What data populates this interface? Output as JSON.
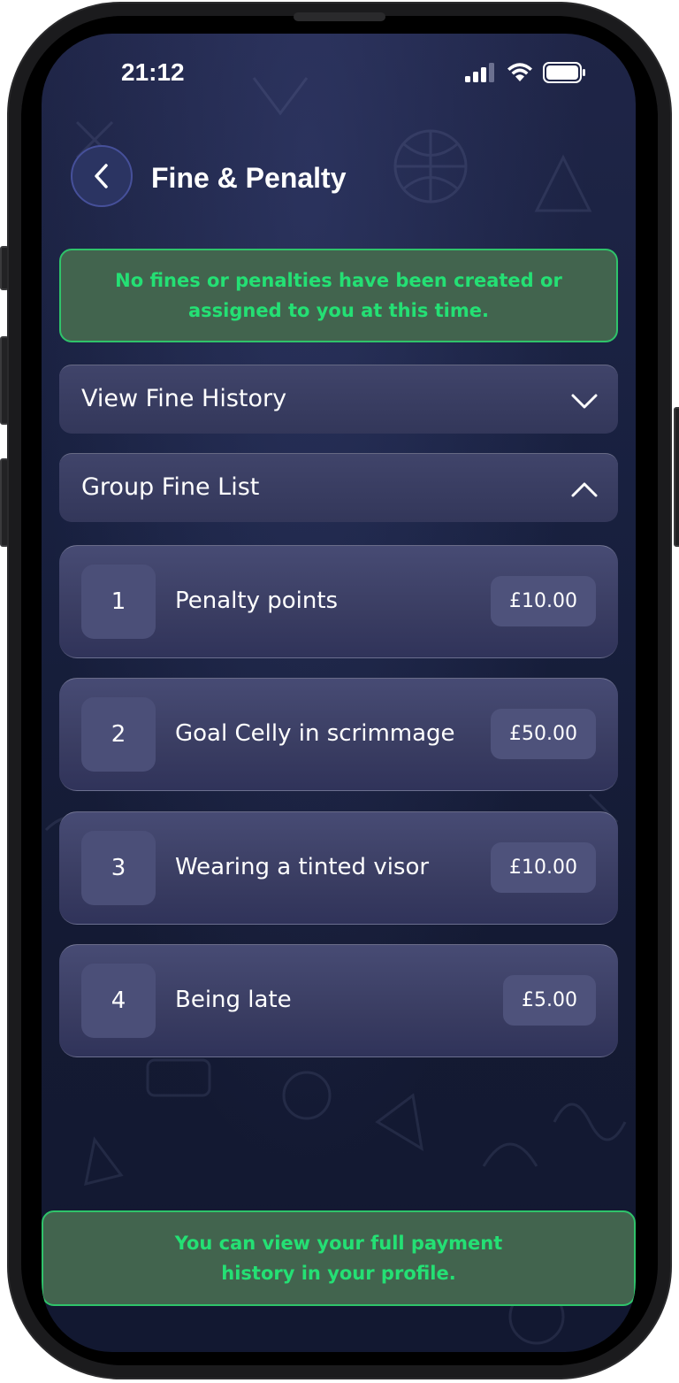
{
  "status_bar": {
    "time": "21:12"
  },
  "header": {
    "title": "Fine & Penalty",
    "back_icon": "chevron-left-icon"
  },
  "notices": {
    "top": "No fines or penalties have been created or assigned to you at this time.",
    "bottom": "You can view your full payment history in your profile."
  },
  "accordions": [
    {
      "label": "View Fine History",
      "state": "collapsed",
      "icon": "chevron-down-icon"
    },
    {
      "label": "Group Fine List",
      "state": "expanded",
      "icon": "chevron-up-icon"
    }
  ],
  "fines": [
    {
      "index": "1",
      "name": "Penalty points",
      "amount": "£10.00"
    },
    {
      "index": "2",
      "name": "Goal Celly in scrimmage",
      "amount": "£50.00"
    },
    {
      "index": "3",
      "name": "Wearing a tinted visor",
      "amount": "£10.00"
    },
    {
      "index": "4",
      "name": "Being late",
      "amount": "£5.00"
    }
  ],
  "colors": {
    "background": "#161c38",
    "notice_bg": "#42644e",
    "notice_text": "#24e074",
    "card": "#3a3d62"
  }
}
